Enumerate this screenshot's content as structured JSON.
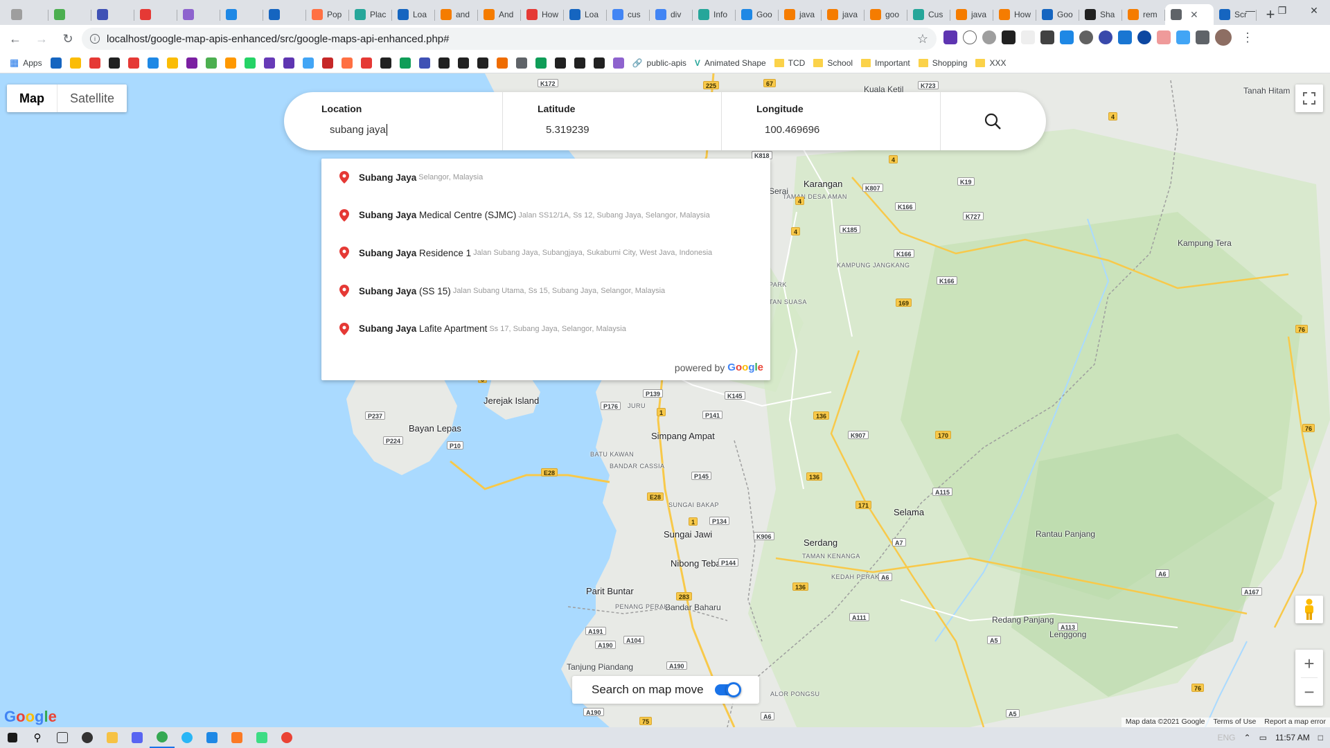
{
  "browser": {
    "tabs": [
      {
        "label": "",
        "color": "#9e9e9e"
      },
      {
        "label": "",
        "color": "#4caf50"
      },
      {
        "label": "",
        "color": "#3f51b5"
      },
      {
        "label": "",
        "color": "#e53935"
      },
      {
        "label": "",
        "color": "#8e63ce"
      },
      {
        "label": "",
        "color": "#1e88e5"
      },
      {
        "label": "",
        "color": "#1565c0"
      },
      {
        "label": "Pop",
        "color": "#ff7043"
      },
      {
        "label": "Plac",
        "color": "#26a69a"
      },
      {
        "label": "Loa",
        "color": "#1565c0"
      },
      {
        "label": "and",
        "color": "#f57c00"
      },
      {
        "label": "And",
        "color": "#f57c00"
      },
      {
        "label": "How",
        "color": "#e53935"
      },
      {
        "label": "Loa",
        "color": "#1565c0"
      },
      {
        "label": "cus",
        "color": "#4285f4"
      },
      {
        "label": "div",
        "color": "#4285f4"
      },
      {
        "label": "Info",
        "color": "#26a69a"
      },
      {
        "label": "Goo",
        "color": "#1e88e5"
      },
      {
        "label": "java",
        "color": "#f57c00"
      },
      {
        "label": "java",
        "color": "#f57c00"
      },
      {
        "label": "goo",
        "color": "#f57c00"
      },
      {
        "label": "Cus",
        "color": "#26a69a"
      },
      {
        "label": "java",
        "color": "#f57c00"
      },
      {
        "label": "How",
        "color": "#f57c00"
      },
      {
        "label": "Goo",
        "color": "#1565c0"
      },
      {
        "label": "Sha",
        "color": "#212121"
      },
      {
        "label": "rem",
        "color": "#f57c00"
      }
    ],
    "active_tab": {
      "label": "",
      "color": "#5f6368"
    },
    "last_tab": {
      "label": "Scr",
      "color": "#1565c0"
    },
    "url": "localhost/google-map-apis-enhanced/src/google-maps-api-enhanced.php#",
    "bookmarks": {
      "apps_label": "Apps",
      "named": [
        "public-apis",
        "Animated Shape"
      ],
      "folders": [
        "TCD",
        "School",
        "Important",
        "Shopping",
        "XXX"
      ]
    }
  },
  "map": {
    "type_controls": {
      "map": "Map",
      "satellite": "Satellite"
    },
    "search": {
      "location_label": "Location",
      "location_value": "subang jaya",
      "latitude_label": "Latitude",
      "latitude_value": "5.319239",
      "longitude_label": "Longitude",
      "longitude_value": "100.469696"
    },
    "suggestions": [
      {
        "match": "Subang Jaya",
        "rest": "",
        "secondary": "Selangor, Malaysia"
      },
      {
        "match": "Subang Jaya",
        "rest": " Medical Centre (SJMC)",
        "secondary": "Jalan SS12/1A, Ss 12, Subang Jaya, Selangor, Malaysia"
      },
      {
        "match": "Subang Jaya",
        "rest": " Residence 1",
        "secondary": "Jalan Subang Jaya, Subangjaya, Sukabumi City, West Java, Indonesia"
      },
      {
        "match": "Subang Jaya",
        "rest": " (SS 15)",
        "secondary": "Jalan Subang Utama, Ss 15, Subang Jaya, Selangor, Malaysia"
      },
      {
        "match": "Subang Jaya",
        "rest": " Lafite Apartment",
        "secondary": "Ss 17, Subang Jaya, Selangor, Malaysia"
      }
    ],
    "powered_by": "powered by",
    "google_word": "Google",
    "search_on_move": "Search on map move",
    "search_on_move_enabled": true,
    "attribution": {
      "data": "Map data ©2021 Google",
      "terms": "Terms of Use",
      "report": "Report a map error"
    },
    "places": [
      {
        "name": "Kuala Ketil",
        "cls": "label"
      },
      {
        "name": "Tanah Hitam",
        "cls": "label"
      },
      {
        "name": "Karangan",
        "cls": "label big"
      },
      {
        "name": "TAMAN DESA AMAN",
        "cls": "label small"
      },
      {
        "name": "Kampung Tera",
        "cls": "label"
      },
      {
        "name": "KAMPUNG JANGKANG",
        "cls": "label small"
      },
      {
        "name": "Jerejak Island",
        "cls": "label big"
      },
      {
        "name": "Bayan Lepas",
        "cls": "label big"
      },
      {
        "name": "Simpang Ampat",
        "cls": "label big"
      },
      {
        "name": "JURU",
        "cls": "label small"
      },
      {
        "name": "BATU KAWAN",
        "cls": "label small"
      },
      {
        "name": "BANDAR CASSIA",
        "cls": "label small"
      },
      {
        "name": "SUNGAI BAKAP",
        "cls": "label small"
      },
      {
        "name": "Sungai Jawi",
        "cls": "label big"
      },
      {
        "name": "Nibong Tebal",
        "cls": "label big"
      },
      {
        "name": "Parit Buntar",
        "cls": "label big"
      },
      {
        "name": "Bandar Baharu",
        "cls": "label"
      },
      {
        "name": "Tanjung Piandang",
        "cls": "label"
      },
      {
        "name": "Serdang",
        "cls": "label big"
      },
      {
        "name": "TAMAN KENANGA",
        "cls": "label small"
      },
      {
        "name": "Selama",
        "cls": "label big"
      },
      {
        "name": "Rantau Panjang",
        "cls": "label"
      },
      {
        "name": "Redang Panjang",
        "cls": "label"
      },
      {
        "name": "Lenggong",
        "cls": "label"
      },
      {
        "name": "ALOR PONGSU",
        "cls": "label small"
      },
      {
        "name": "KEDAH PERAK",
        "cls": "label small"
      },
      {
        "name": "PENANG PERAK",
        "cls": "label small"
      },
      {
        "name": "Serai",
        "cls": "label"
      },
      {
        "name": "PARK",
        "cls": "label small"
      },
      {
        "name": "TAN SUASA",
        "cls": "label small"
      }
    ],
    "shields": [
      "K172",
      "225",
      "67",
      "K723",
      "4",
      "K818",
      "4",
      "K19",
      "4",
      "K807",
      "K166",
      "K727",
      "4",
      "K185",
      "K166",
      "169",
      "K166",
      "76",
      "6",
      "P139",
      "K145",
      "P176",
      "1",
      "P141",
      "136",
      "P237",
      "P224",
      "P10",
      "K907",
      "170",
      "E28",
      "P145",
      "E28",
      "136",
      "A115",
      "76",
      "P134",
      "1",
      "171",
      "A7",
      "K906",
      "P144",
      "136",
      "A6",
      "A6",
      "283",
      "A111",
      "A191",
      "A104",
      "A190",
      "A190",
      "A167",
      "A113",
      "A5",
      "A190",
      "76",
      "A6",
      "A5",
      "75"
    ],
    "colors": {
      "water": "#aadaff",
      "land": "#e8eae6",
      "forest": "#c8e6c0",
      "highway": "#f8c94a",
      "toggle": "#1a73e8"
    }
  },
  "taskbar": {
    "time": "11:57 AM",
    "lang": "ENG"
  }
}
